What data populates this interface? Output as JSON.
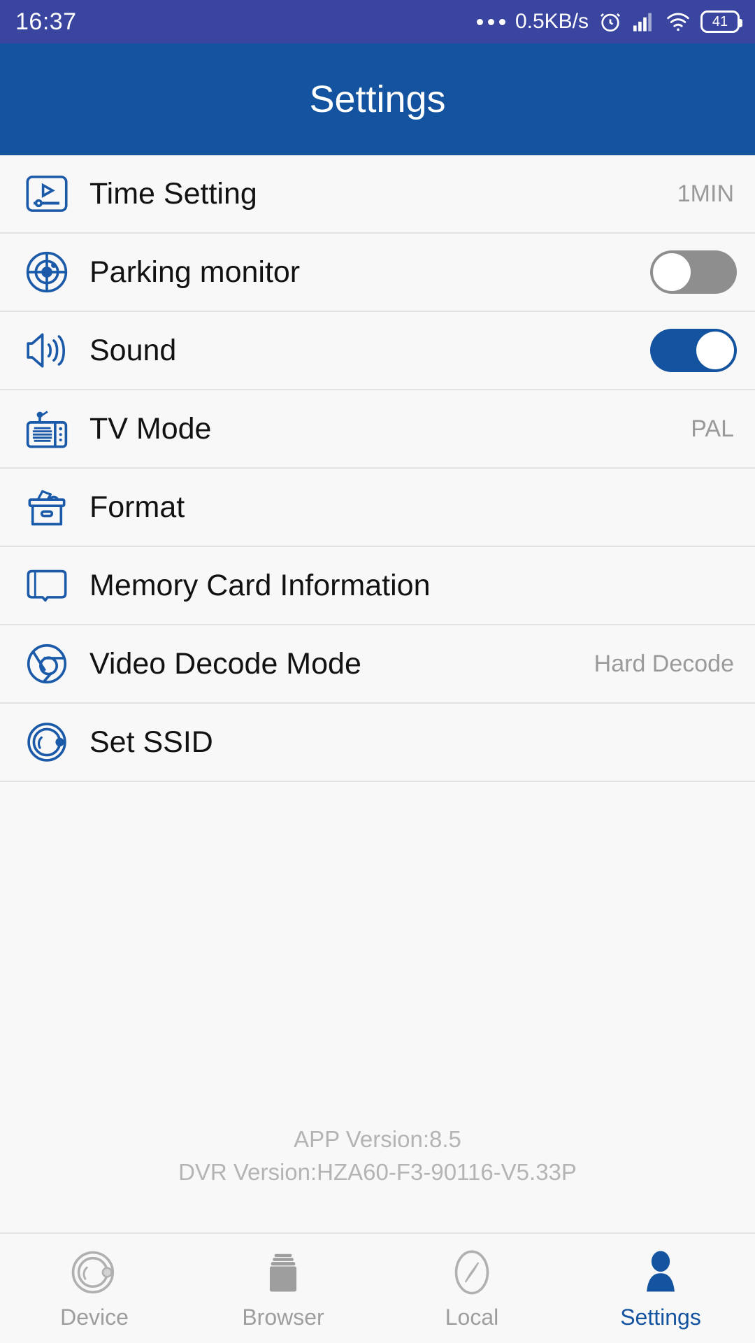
{
  "statusbar": {
    "time": "16:37",
    "network_speed": "0.5KB/s",
    "battery_level": "41",
    "icons": [
      "more-dots-icon",
      "alarm-icon",
      "cellular-signal-icon",
      "wifi-icon",
      "battery-icon"
    ]
  },
  "header": {
    "title": "Settings",
    "bg_color": "#14539f"
  },
  "settings_list": [
    {
      "icon": "time-setting-icon",
      "label": "Time Setting",
      "value": "1MIN",
      "control": "value"
    },
    {
      "icon": "parking-monitor-icon",
      "label": "Parking monitor",
      "value": "",
      "control": "toggle",
      "toggle_state": "off"
    },
    {
      "icon": "sound-icon",
      "label": "Sound",
      "value": "",
      "control": "toggle",
      "toggle_state": "on"
    },
    {
      "icon": "tv-mode-icon",
      "label": "TV Mode",
      "value": "PAL",
      "control": "value"
    },
    {
      "icon": "format-icon",
      "label": "Format",
      "value": "",
      "control": "none"
    },
    {
      "icon": "memory-card-icon",
      "label": "Memory Card Information",
      "value": "",
      "control": "none"
    },
    {
      "icon": "video-decode-icon",
      "label": "Video Decode Mode",
      "value": "Hard Decode",
      "control": "value"
    },
    {
      "icon": "set-ssid-icon",
      "label": "Set SSID",
      "value": "",
      "control": "none"
    }
  ],
  "versions": {
    "app": "APP Version:8.5",
    "dvr": "DVR Version:HZA60-F3-90116-V5.33P"
  },
  "bottom_nav": [
    {
      "icon": "device-icon",
      "label": "Device",
      "active": false
    },
    {
      "icon": "browser-icon",
      "label": "Browser",
      "active": false
    },
    {
      "icon": "local-compass-icon",
      "label": "Local",
      "active": false
    },
    {
      "icon": "settings-person-icon",
      "label": "Settings",
      "active": true
    }
  ],
  "colors": {
    "accent_blue": "#14539f",
    "statusbar_blue": "#3a45a0",
    "background": "#f8f8f8",
    "divider": "#e2e2e2",
    "muted_text": "#9a9a9a",
    "toggle_off": "#8e8e8e"
  }
}
